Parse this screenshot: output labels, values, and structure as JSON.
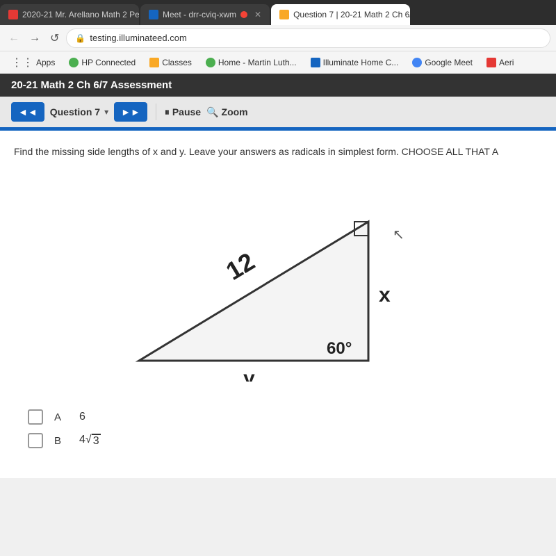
{
  "browser": {
    "tabs": [
      {
        "id": "tab1",
        "icon_type": "red",
        "label": "2020-21 Mr. Arellano Math 2 Per",
        "active": false,
        "closable": true
      },
      {
        "id": "tab2",
        "icon_type": "blue",
        "label": "Meet - drr-cviq-xwm",
        "active": false,
        "closable": true,
        "has_dot": true
      },
      {
        "id": "tab3",
        "icon_type": "yellow",
        "label": "Question 7 | 20-21 Math 2 Ch 6/",
        "active": true,
        "closable": true
      }
    ],
    "nav": {
      "back_label": "←",
      "forward_label": "→",
      "refresh_label": "↺",
      "url": "testing.illuminateed.com"
    },
    "bookmarks": [
      {
        "id": "apps",
        "label": "Apps",
        "icon": "grid"
      },
      {
        "id": "hp",
        "label": "HP Connected",
        "icon": "circle-green"
      },
      {
        "id": "classes",
        "label": "Classes",
        "icon": "square-yellow"
      },
      {
        "id": "home",
        "label": "Home - Martin Luth...",
        "icon": "circle-green"
      },
      {
        "id": "illuminate",
        "label": "Illuminate Home C...",
        "icon": "square-blue"
      },
      {
        "id": "google",
        "label": "Google Meet",
        "icon": "circle-multi"
      },
      {
        "id": "aeri",
        "label": "Aeri",
        "icon": "square-red"
      }
    ]
  },
  "assessment": {
    "title": "20-21 Math 2 Ch 6/7 Assessment",
    "controls": {
      "prev_label": "◄◄",
      "question_label": "Question 7",
      "next_label": "►►",
      "pause_label": "Pause",
      "zoom_label": "Zoom"
    },
    "question": {
      "text": "Find the missing side lengths of x and y. Leave your answers as radicals in simplest form. CHOOSE ALL THAT A",
      "triangle": {
        "hypotenuse": "12",
        "side_x": "x",
        "angle": "60°",
        "side_y": "y",
        "right_angle": true
      }
    },
    "answers": [
      {
        "id": "A",
        "letter": "A",
        "value": "6",
        "type": "plain"
      },
      {
        "id": "B",
        "letter": "B",
        "value": "4√3",
        "type": "sqrt",
        "coefficient": "4",
        "radicand": "3"
      }
    ]
  }
}
